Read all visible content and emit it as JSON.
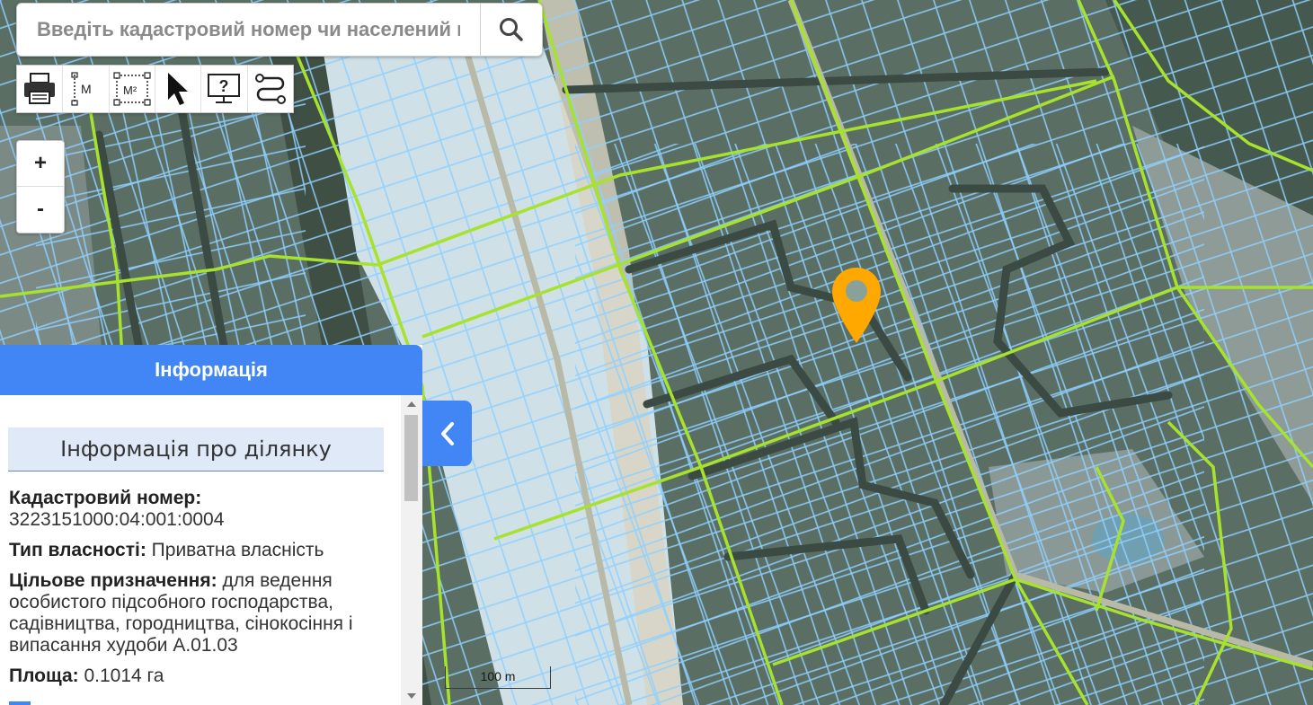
{
  "search": {
    "placeholder": "Введіть кадастровий номер чи населений пу"
  },
  "toolbar": {
    "tools": [
      {
        "name": "print",
        "icon": "printer-icon"
      },
      {
        "name": "measure-distance",
        "icon": "measure-distance-icon",
        "label": "M"
      },
      {
        "name": "measure-area",
        "icon": "measure-area-icon",
        "label": "M²"
      },
      {
        "name": "select",
        "icon": "cursor-arrow-icon"
      },
      {
        "name": "identify",
        "icon": "monitor-help-icon",
        "label": "?"
      },
      {
        "name": "route",
        "icon": "route-icon"
      }
    ]
  },
  "zoom": {
    "in_label": "+",
    "out_label": "-"
  },
  "panel": {
    "header": "Інформація",
    "section_title": "Інформація про ділянку",
    "fields": {
      "cadastral_label": "Кадастровий номер:",
      "cadastral_value": "3223151000:04:001:0004",
      "ownership_label": "Тип власності:",
      "ownership_value": "Приватна власність",
      "purpose_label": "Цільове призначення:",
      "purpose_value": "для ведення особистого підсобного господарства, садівництва, городництва, сінокосіння і випасання худоби А.01.03",
      "area_label": "Площа:",
      "area_value": "0.1014 га"
    }
  },
  "scale_bar": {
    "label": "100 m"
  },
  "colors": {
    "accent": "#4285f4",
    "parcel_outline": "#8fd0ff",
    "boundary_line": "#a6e22e",
    "marker": "#ffa800"
  }
}
